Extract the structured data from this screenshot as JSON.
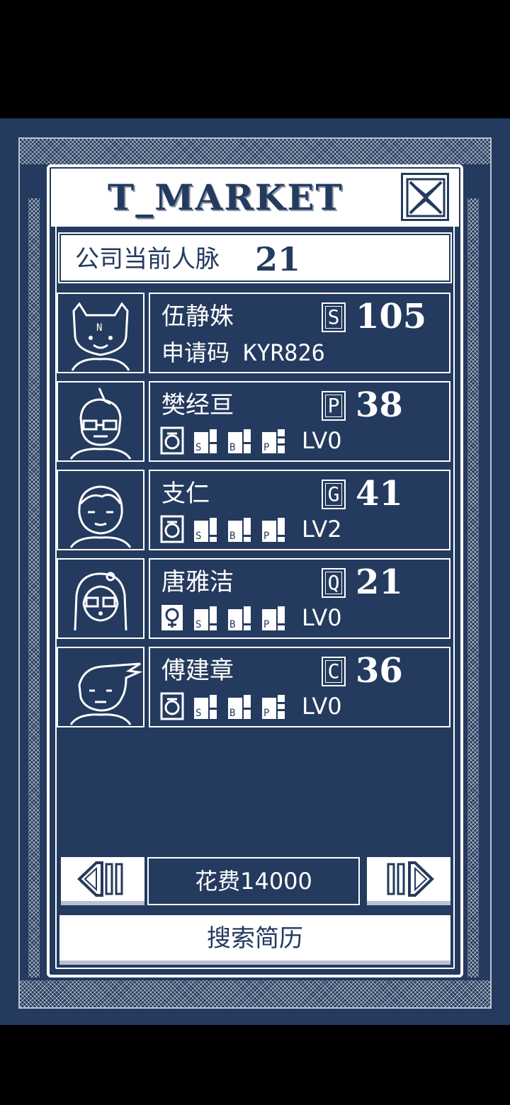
{
  "market": {
    "title": "T_MARKET",
    "contacts_label": "公司当前人脉",
    "contacts_value": "21"
  },
  "candidates": [
    {
      "name": "伍静姝",
      "grade": "S",
      "score": "105",
      "subtitle": "申请码 KYR826",
      "stats": null,
      "level": ""
    },
    {
      "name": "樊经亘",
      "grade": "P",
      "score": "38",
      "subtitle": "",
      "gender_icon": "male-icon",
      "stats": [
        "S",
        "B",
        "P"
      ],
      "level": "LV0"
    },
    {
      "name": "支仁",
      "grade": "G",
      "score": "41",
      "subtitle": "",
      "gender_icon": "male-icon",
      "stats": [
        "S",
        "B",
        "P"
      ],
      "level": "LV2"
    },
    {
      "name": "唐雅洁",
      "grade": "Q",
      "score": "21",
      "subtitle": "",
      "gender_icon": "female-icon",
      "stats": [
        "S",
        "B",
        "P"
      ],
      "level": "LV0"
    },
    {
      "name": "傅建章",
      "grade": "C",
      "score": "36",
      "subtitle": "",
      "gender_icon": "male-icon",
      "stats": [
        "S",
        "B",
        "P"
      ],
      "level": "LV0"
    }
  ],
  "footer": {
    "cost_label": "花费14000",
    "search_label": "搜索简历"
  },
  "colors": {
    "navy": "#243a5e",
    "white": "#ffffff",
    "grey": "#b9c2d2"
  }
}
